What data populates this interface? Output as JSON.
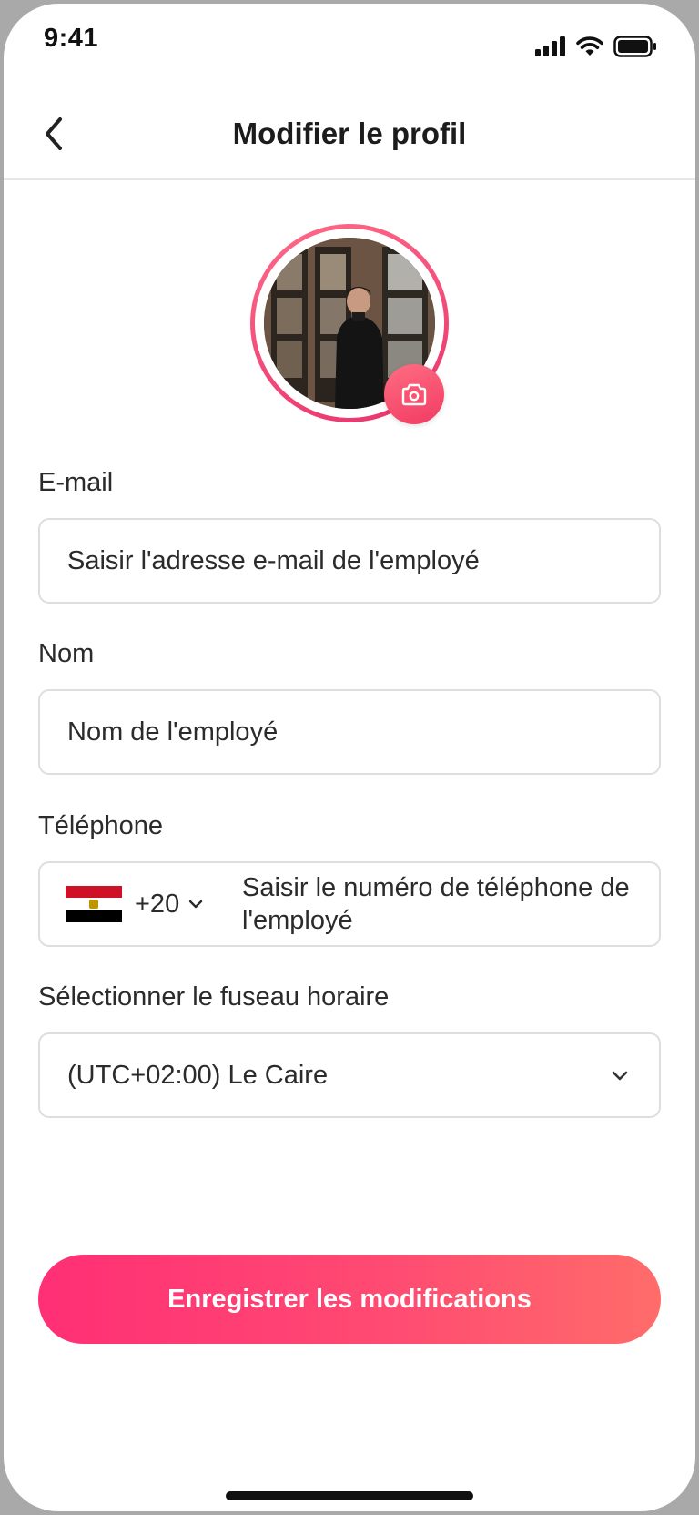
{
  "status_bar": {
    "time": "9:41",
    "icons": [
      "signal-icon",
      "wifi-icon",
      "battery-icon"
    ]
  },
  "header": {
    "title": "Modifier le profil",
    "back_icon": "chevron-left-icon"
  },
  "avatar": {
    "camera_icon": "camera-icon"
  },
  "form": {
    "email": {
      "label": "E-mail",
      "placeholder": "Saisir l'adresse e-mail de l'employé"
    },
    "name": {
      "label": "Nom",
      "placeholder": "Nom de l'employé"
    },
    "phone": {
      "label": "Téléphone",
      "country_flag": "egypt-flag",
      "dial_code": "+20",
      "placeholder": "Saisir le numéro de téléphone de l'employé"
    },
    "timezone": {
      "label": "Sélectionner le fuseau horaire",
      "value": "(UTC+02:00) Le Caire"
    }
  },
  "actions": {
    "save_label": "Enregistrer les modifications"
  },
  "colors": {
    "accent": "#FF3D73",
    "accent_end": "#FF6C6A",
    "border": "#DEDEDE",
    "text": "#2B2B2B"
  }
}
